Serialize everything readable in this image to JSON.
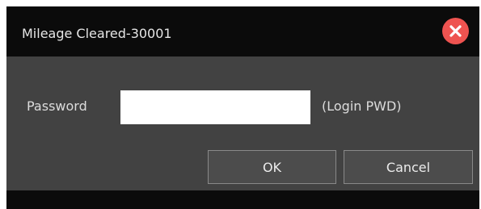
{
  "dialog": {
    "title": "Mileage Cleared-30001",
    "close_icon": "close-icon",
    "close_color": "#ee5350"
  },
  "form": {
    "password_label": "Password",
    "password_value": "",
    "password_hint": "(Login PWD)"
  },
  "buttons": {
    "ok_label": "OK",
    "cancel_label": "Cancel"
  },
  "colors": {
    "titlebar": "#0b0b0b",
    "content": "#424242",
    "button": "#4c4c4c",
    "button_border": "#898989"
  }
}
